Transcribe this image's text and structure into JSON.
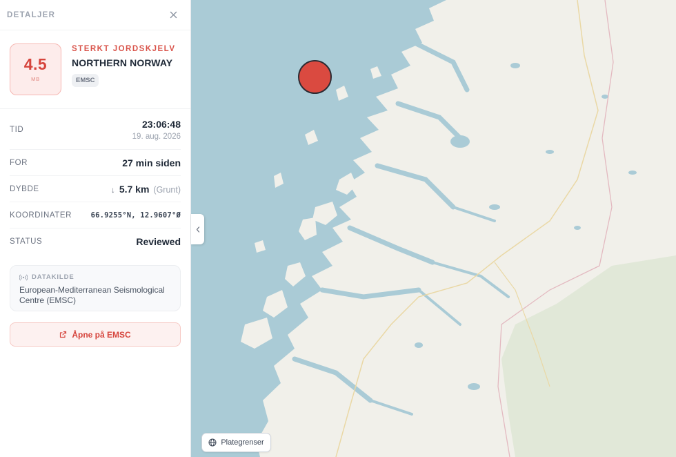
{
  "panel": {
    "title": "DETALJER"
  },
  "quake": {
    "magnitude": "4.5",
    "magnitude_unit": "MB",
    "classification": "STERKT JORDSKJELV",
    "region": "NORTHERN NORWAY",
    "source_badge": "EMSC"
  },
  "details": {
    "time_label": "TID",
    "time_value": "23:06:48",
    "date_value": "19. aug. 2026",
    "ago_label": "FOR",
    "ago_value": "27 min siden",
    "depth_label": "DYBDE",
    "depth_arrow": "↓",
    "depth_value": "5.7 km",
    "depth_note": "(Grunt)",
    "coord_label": "KOORDINATER",
    "coord_value": "66.9255°N, 12.9607°Ø",
    "status_label": "STATUS",
    "status_value": "Reviewed"
  },
  "datasource": {
    "label": "DATAKILDE",
    "name": "European-Mediterranean Seismological Centre (EMSC)"
  },
  "actions": {
    "open_label": "Åpne på EMSC"
  },
  "map": {
    "plate_toggle_label": "Plategrenser",
    "collapse_icon": "chevron-left-icon",
    "colors": {
      "sea": "#aacbd6",
      "land": "#f1f0ea",
      "forest": "#e1e8d8",
      "marker": "#da4a40",
      "border": "#e3b9c0"
    }
  },
  "colors": {
    "accent": "#d6453d",
    "accent_soft": "#fdeceb"
  }
}
